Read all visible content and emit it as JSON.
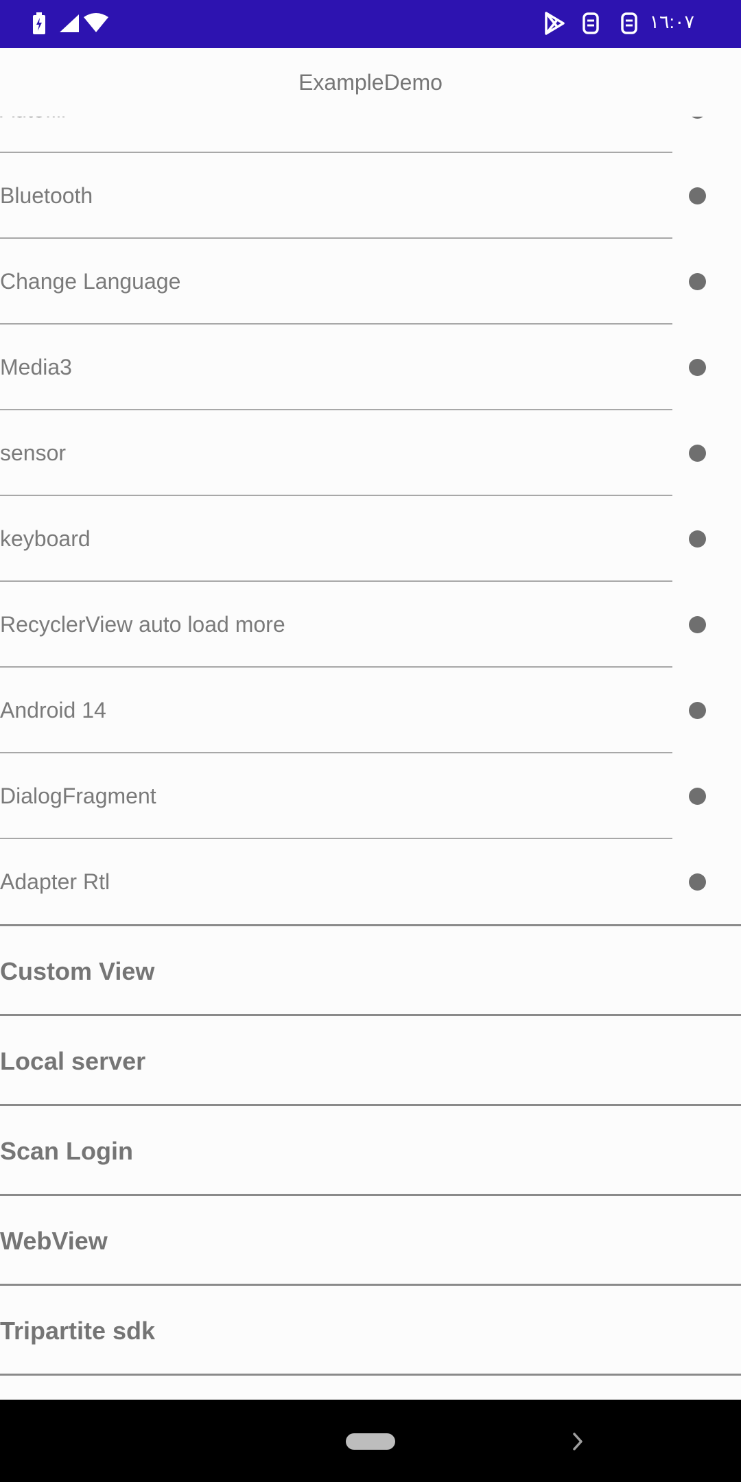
{
  "status_bar": {
    "time": "١٦:٠٧",
    "icons": [
      "battery-charging-icon",
      "signal-icon",
      "wifi-icon",
      "play-store-icon",
      "sim-icon",
      "sim-icon"
    ]
  },
  "app_bar": {
    "title": "ExampleDemo"
  },
  "list": {
    "sub_items": [
      {
        "label": "Autofill"
      },
      {
        "label": "Bluetooth"
      },
      {
        "label": "Change Language"
      },
      {
        "label": "Media3"
      },
      {
        "label": "sensor"
      },
      {
        "label": "keyboard"
      },
      {
        "label": "RecyclerView auto load more"
      },
      {
        "label": "Android 14"
      },
      {
        "label": "DialogFragment"
      },
      {
        "label": "Adapter Rtl"
      }
    ],
    "sections": [
      {
        "label": "Custom View"
      },
      {
        "label": "Local server"
      },
      {
        "label": "Scan Login"
      },
      {
        "label": "WebView"
      },
      {
        "label": "Tripartite sdk"
      }
    ]
  },
  "nav_bar": {
    "icons": [
      "home-pill-icon",
      "chevron-right-icon"
    ]
  },
  "colors": {
    "status_bar": "#2d13b0",
    "background": "#fcfcfc",
    "text": "#757575"
  }
}
